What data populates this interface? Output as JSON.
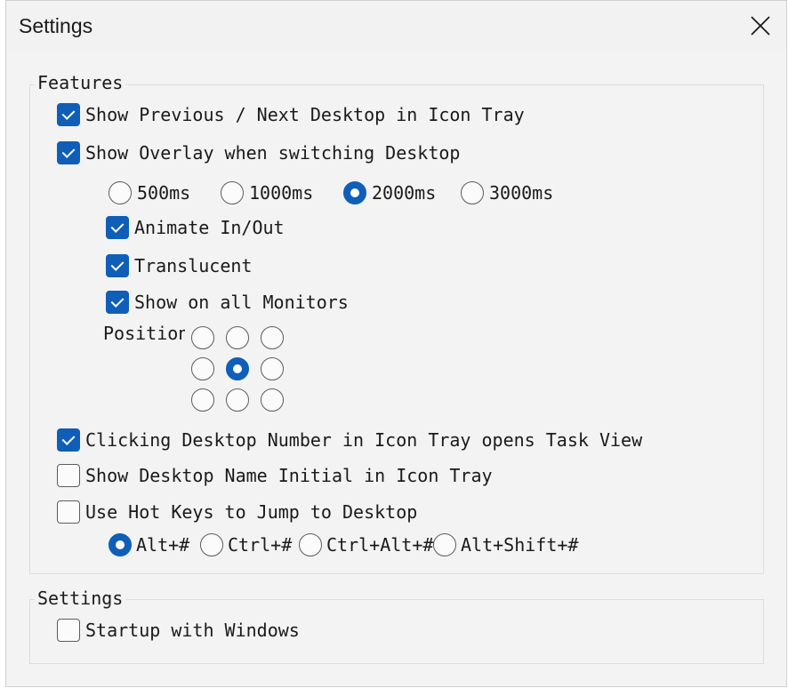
{
  "window": {
    "title": "Settings",
    "close_icon": "close-icon"
  },
  "features": {
    "legend": "Features",
    "show_prev_next": {
      "label": "Show Previous / Next Desktop in Icon Tray",
      "checked": true
    },
    "show_overlay": {
      "label": "Show Overlay when switching Desktop",
      "checked": true
    },
    "durations": [
      {
        "label": "500ms",
        "selected": false
      },
      {
        "label": "1000ms",
        "selected": false
      },
      {
        "label": "2000ms",
        "selected": true
      },
      {
        "label": "3000ms",
        "selected": false
      }
    ],
    "animate": {
      "label": "Animate In/Out",
      "checked": true
    },
    "translucent": {
      "label": "Translucent",
      "checked": true
    },
    "all_monitors": {
      "label": "Show on all Monitors",
      "checked": true
    },
    "position": {
      "label": "Position",
      "selected_row": 1,
      "selected_col": 1
    },
    "click_task_view": {
      "label": "Clicking Desktop Number in Icon Tray opens Task View",
      "checked": true
    },
    "name_initial": {
      "label": "Show Desktop Name Initial in Icon Tray",
      "checked": false
    },
    "hot_keys": {
      "label": "Use Hot Keys to Jump to Desktop",
      "checked": false
    },
    "hotkey_options": [
      {
        "label": "Alt+#",
        "selected": true
      },
      {
        "label": "Ctrl+#",
        "selected": false
      },
      {
        "label": "Ctrl+Alt+#",
        "selected": false
      },
      {
        "label": "Alt+Shift+#",
        "selected": false
      }
    ]
  },
  "settings": {
    "legend": "Settings",
    "startup": {
      "label": "Startup with Windows",
      "checked": false
    }
  },
  "colors": {
    "accent": "#0f5fb8",
    "window_bg": "#f3f3f3",
    "border": "#dcdcdc"
  }
}
